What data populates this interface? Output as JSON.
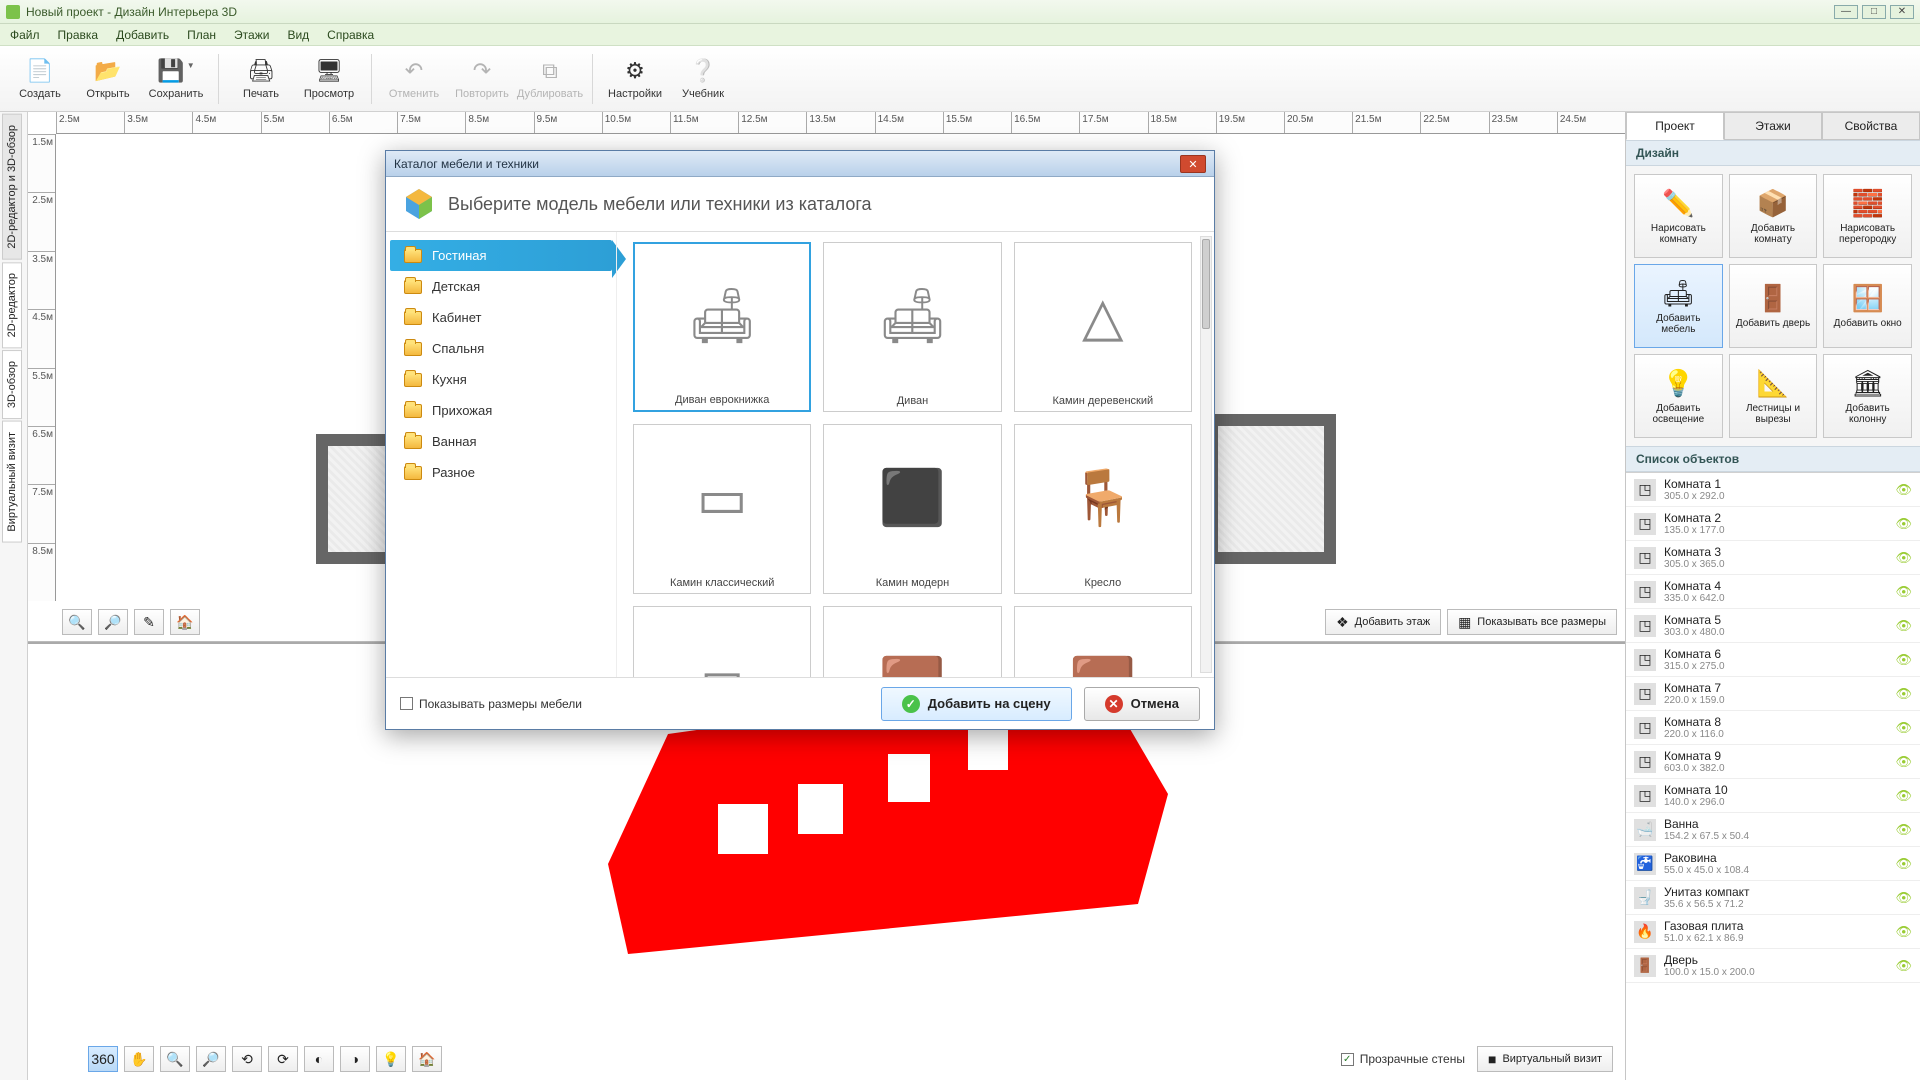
{
  "window": {
    "title": "Новый проект - Дизайн Интерьера 3D"
  },
  "menu": [
    "Файл",
    "Правка",
    "Добавить",
    "План",
    "Этажи",
    "Вид",
    "Справка"
  ],
  "toolbar": [
    {
      "label": "Создать",
      "icon": "📄",
      "enabled": true
    },
    {
      "label": "Открыть",
      "icon": "📂",
      "enabled": true
    },
    {
      "label": "Сохранить",
      "icon": "💾",
      "enabled": true,
      "dropdown": true
    },
    {
      "sep": true
    },
    {
      "label": "Печать",
      "icon": "🖨",
      "enabled": true
    },
    {
      "label": "Просмотр",
      "icon": "🖥",
      "enabled": true
    },
    {
      "sep": true
    },
    {
      "label": "Отменить",
      "icon": "↶",
      "enabled": false
    },
    {
      "label": "Повторить",
      "icon": "↷",
      "enabled": false
    },
    {
      "label": "Дублировать",
      "icon": "⧉",
      "enabled": false
    },
    {
      "sep": true
    },
    {
      "label": "Настройки",
      "icon": "⚙",
      "enabled": true
    },
    {
      "label": "Учебник",
      "icon": "❔",
      "enabled": true
    }
  ],
  "viewtabs": [
    "2D-редактор и 3D-обзор",
    "2D-редактор",
    "3D-обзор",
    "Виртуальный визит"
  ],
  "ruler_h": [
    "2.5м",
    "3.5м",
    "4.5м",
    "5.5м",
    "6.5м",
    "7.5м",
    "8.5м",
    "9.5м",
    "10.5м",
    "11.5м",
    "12.5м",
    "13.5м",
    "14.5м",
    "15.5м",
    "16.5м",
    "17.5м",
    "18.5м",
    "19.5м",
    "20.5м",
    "21.5м",
    "22.5м",
    "23.5м",
    "24.5м"
  ],
  "ruler_v": [
    "1.5м",
    "2.5м",
    "3.5м",
    "4.5м",
    "5.5м",
    "6.5м",
    "7.5м",
    "8.5м"
  ],
  "canvas2d_btns": {
    "add_floor": "Добавить этаж",
    "show_dims": "Показывать все размеры"
  },
  "canvas3d": {
    "transparent_walls": "Прозрачные стены",
    "virtual_visit": "Виртуальный визит"
  },
  "right": {
    "tabs": [
      "Проект",
      "Этажи",
      "Свойства"
    ],
    "design_head": "Дизайн",
    "tools": [
      {
        "label": "Нарисовать комнату",
        "icon": "✏️"
      },
      {
        "label": "Добавить комнату",
        "icon": "📦"
      },
      {
        "label": "Нарисовать перегородку",
        "icon": "🧱"
      },
      {
        "label": "Добавить мебель",
        "icon": "🛋",
        "active": true
      },
      {
        "label": "Добавить дверь",
        "icon": "🚪"
      },
      {
        "label": "Добавить окно",
        "icon": "🪟"
      },
      {
        "label": "Добавить освещение",
        "icon": "💡"
      },
      {
        "label": "Лестницы и вырезы",
        "icon": "📐"
      },
      {
        "label": "Добавить колонну",
        "icon": "🏛"
      }
    ],
    "objects_head": "Список объектов",
    "objects": [
      {
        "name": "Комната 1",
        "dim": "305.0 x 292.0",
        "icon": "◳"
      },
      {
        "name": "Комната 2",
        "dim": "135.0 x 177.0",
        "icon": "◳"
      },
      {
        "name": "Комната 3",
        "dim": "305.0 x 365.0",
        "icon": "◳"
      },
      {
        "name": "Комната 4",
        "dim": "335.0 x 642.0",
        "icon": "◳"
      },
      {
        "name": "Комната 5",
        "dim": "303.0 x 480.0",
        "icon": "◳"
      },
      {
        "name": "Комната 6",
        "dim": "315.0 x 275.0",
        "icon": "◳"
      },
      {
        "name": "Комната 7",
        "dim": "220.0 x 159.0",
        "icon": "◳"
      },
      {
        "name": "Комната 8",
        "dim": "220.0 x 116.0",
        "icon": "◳"
      },
      {
        "name": "Комната 9",
        "dim": "603.0 x 382.0",
        "icon": "◳"
      },
      {
        "name": "Комната 10",
        "dim": "140.0 x 296.0",
        "icon": "◳"
      },
      {
        "name": "Ванна",
        "dim": "154.2 x 67.5 x 50.4",
        "icon": "🛁"
      },
      {
        "name": "Раковина",
        "dim": "55.0 x 45.0 x 108.4",
        "icon": "🚰"
      },
      {
        "name": "Унитаз компакт",
        "dim": "35.6 x 56.5 x 71.2",
        "icon": "🚽"
      },
      {
        "name": "Газовая плита",
        "dim": "51.0 x 62.1 x 86.9",
        "icon": "🔥"
      },
      {
        "name": "Дверь",
        "dim": "100.0 x 15.0 x 200.0",
        "icon": "🚪"
      }
    ]
  },
  "modal": {
    "title": "Каталог мебели и техники",
    "heading": "Выберите модель мебели или техники из каталога",
    "categories": [
      "Гостиная",
      "Детская",
      "Кабинет",
      "Спальня",
      "Кухня",
      "Прихожая",
      "Ванная",
      "Разное"
    ],
    "items": [
      {
        "label": "Диван еврокнижка",
        "icon": "🛋",
        "sel": true
      },
      {
        "label": "Диван",
        "icon": "🛋"
      },
      {
        "label": "Камин деревенский",
        "icon": "△"
      },
      {
        "label": "Камин классический",
        "icon": "▭"
      },
      {
        "label": "Камин модерн",
        "icon": "⬛"
      },
      {
        "label": "Кресло",
        "icon": "🪑"
      },
      {
        "label": "",
        "icon": "◻"
      },
      {
        "label": "",
        "icon": "🟫"
      },
      {
        "label": "",
        "icon": "🟫"
      }
    ],
    "show_sizes": "Показывать размеры мебели",
    "add_btn": "Добавить на сцену",
    "cancel_btn": "Отмена"
  }
}
